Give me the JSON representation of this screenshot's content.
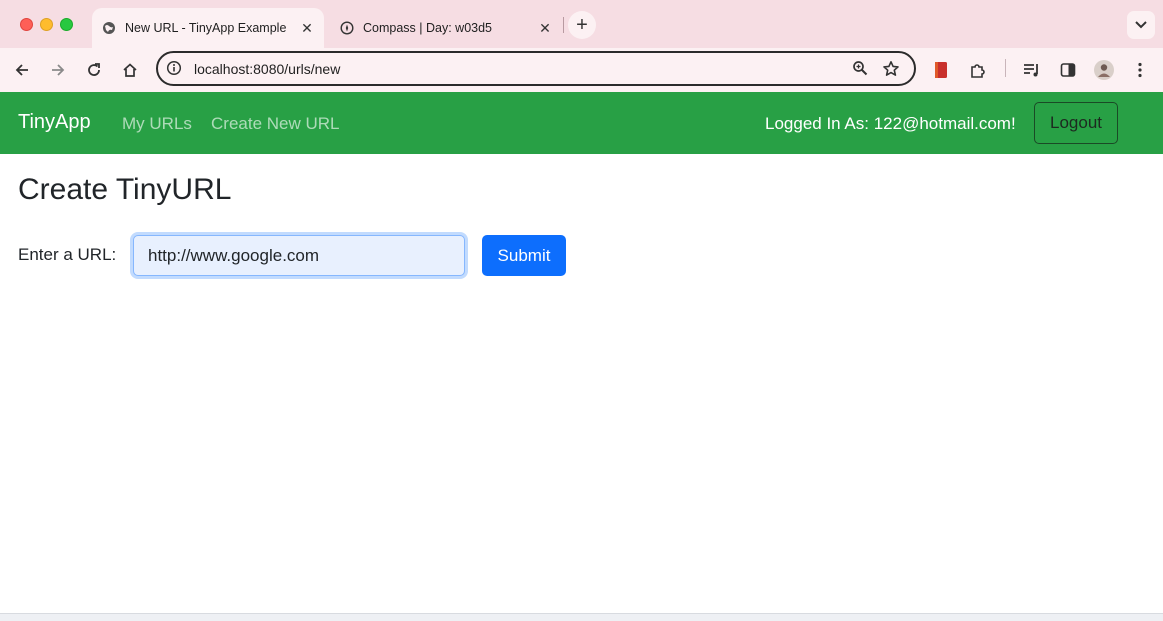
{
  "browser": {
    "tabs": [
      {
        "title": "New URL - TinyApp Example",
        "favicon": "globe-icon",
        "active": true
      },
      {
        "title": "Compass | Day: w03d5",
        "favicon": "compass-icon",
        "active": false
      }
    ],
    "address": "localhost:8080/urls/new"
  },
  "navbar": {
    "brand": "TinyApp",
    "links": [
      "My URLs",
      "Create New URL"
    ],
    "logged_in": "Logged In As: 122@hotmail.com!",
    "logout_label": "Logout",
    "color": "#28a045"
  },
  "main": {
    "title": "Create TinyURL",
    "url_label": "Enter a URL:",
    "url_value": "http://www.google.com",
    "submit_label": "Submit",
    "accent": "#0d6efd"
  }
}
